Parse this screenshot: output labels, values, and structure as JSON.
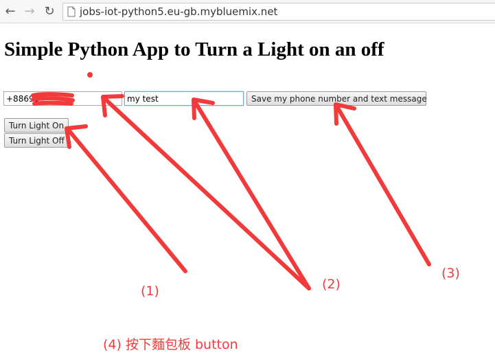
{
  "browser": {
    "url": "jobs-iot-python5.eu-gb.mybluemix.net",
    "back_icon": "arrow-back-icon",
    "forward_icon": "arrow-forward-icon",
    "reload_icon": "reload-icon",
    "page_icon": "page-icon"
  },
  "page": {
    "title": "Simple Python App to Turn a Light on an off",
    "phone_value": "+88693",
    "message_value": "my test",
    "save_label": "Save my phone number and text message",
    "light_on_label": "Turn Light On",
    "light_off_label": "Turn Light Off"
  },
  "annotations": {
    "color": "#f23a3a",
    "label_1": "(1)",
    "label_2": "(2)",
    "label_3": "(3)",
    "label_4": "(4) 按下麵包板 button"
  }
}
